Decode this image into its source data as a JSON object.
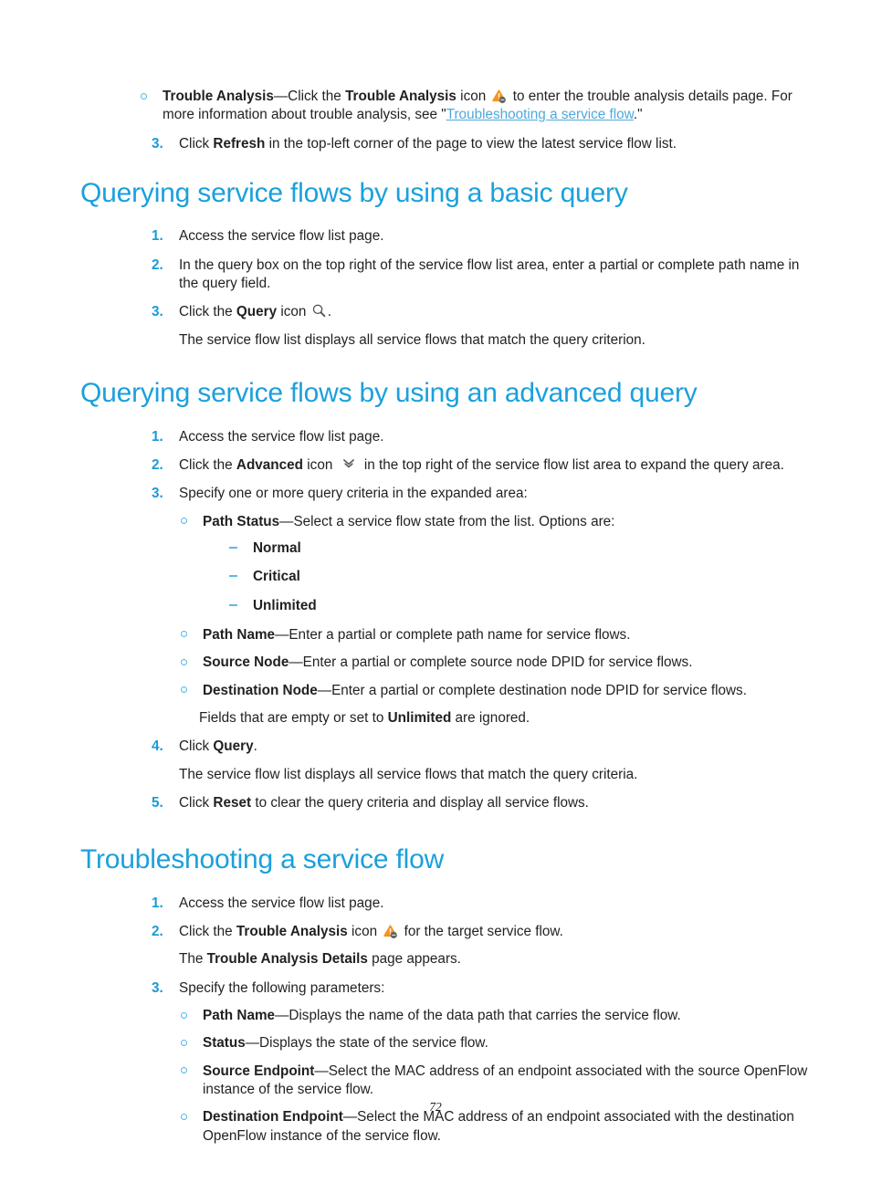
{
  "document": {
    "page_number": "72",
    "heading_color": "#1ba0dc",
    "marker_color": "#1b9ad6",
    "bullet_color": "#4cb8e8",
    "link_color": "#4da9dc",
    "warning_icon_color": "#f7941e"
  },
  "top_continued": {
    "bullet": {
      "term": "Trouble Analysis",
      "dash": "—",
      "text_before_bold": "Click the ",
      "bold_inline": "Trouble Analysis",
      "text_after_bold": " icon ",
      "icon_name": "trouble-analysis-icon",
      "text_after_icon": " to enter the trouble analysis details page. For more information about trouble analysis, see \"",
      "link_text": "Troubleshooting a service flow",
      "text_end": ".\""
    },
    "step3": {
      "number": "3.",
      "text_before": "Click ",
      "bold": "Refresh",
      "text_after": " in the top-left corner of the page to view the latest service flow list."
    }
  },
  "section_basic_query": {
    "heading": "Querying service flows by using a basic query",
    "steps": [
      {
        "number": "1.",
        "text": "Access the service flow list page."
      },
      {
        "number": "2.",
        "text": "In the query box on the top right of the service flow list area, enter a partial or complete path name in the query field."
      },
      {
        "number": "3.",
        "text_before": "Click the ",
        "bold": "Query",
        "text_after": " icon ",
        "icon_name": "search-icon",
        "text_end": ".",
        "sub_paragraph": "The service flow list displays all service flows that match the query criterion."
      }
    ]
  },
  "section_advanced_query": {
    "heading": "Querying service flows by using an advanced query",
    "steps": [
      {
        "number": "1.",
        "text": "Access the service flow list page."
      },
      {
        "number": "2.",
        "text_before": "Click the ",
        "bold": "Advanced",
        "text_after": " icon ",
        "icon_name": "double-chevron-down-icon",
        "text_end": " in the top right of the service flow list area to expand the query area."
      },
      {
        "number": "3.",
        "text": "Specify one or more query criteria in the expanded area:",
        "bullets": [
          {
            "term": "Path Status",
            "dash": "—",
            "description": "Select a service flow state from the list. Options are:",
            "options": [
              "Normal",
              "Critical",
              "Unlimited"
            ]
          },
          {
            "term": "Path Name",
            "dash": "—",
            "description": "Enter a partial or complete path name for service flows."
          },
          {
            "term": "Source Node",
            "dash": "—",
            "description": "Enter a partial or complete source node DPID for service flows."
          },
          {
            "term": "Destination Node",
            "dash": "—",
            "description": "Enter a partial or complete destination node DPID for service flows."
          }
        ],
        "trailing_text_before": "Fields that are empty or set to ",
        "trailing_bold": "Unlimited",
        "trailing_text_after": " are ignored."
      },
      {
        "number": "4.",
        "text_before": "Click ",
        "bold": "Query",
        "text_end": ".",
        "sub_paragraph": "The service flow list displays all service flows that match the query criteria."
      },
      {
        "number": "5.",
        "text_before": "Click ",
        "bold": "Reset",
        "text_end": " to clear the query criteria and display all service flows."
      }
    ]
  },
  "section_troubleshooting": {
    "heading": "Troubleshooting a service flow",
    "steps": [
      {
        "number": "1.",
        "text": "Access the service flow list page."
      },
      {
        "number": "2.",
        "text_before": "Click the ",
        "bold": "Trouble Analysis",
        "text_after": " icon ",
        "icon_name": "trouble-analysis-icon",
        "text_end": " for the target service flow.",
        "sub_before": "The ",
        "sub_bold": "Trouble Analysis Details",
        "sub_after": " page appears."
      },
      {
        "number": "3.",
        "text": "Specify the following parameters:",
        "bullets": [
          {
            "term": "Path Name",
            "dash": "—",
            "description": "Displays the name of the data path that carries the service flow."
          },
          {
            "term": "Status",
            "dash": "—",
            "description": "Displays the state of the service flow."
          },
          {
            "term": "Source Endpoint",
            "dash": "—",
            "description": "Select the MAC address of an endpoint associated with the source OpenFlow instance of the service flow."
          },
          {
            "term": "Destination Endpoint",
            "dash": "—",
            "description": "Select the MAC address of an endpoint associated with the destination OpenFlow instance of the service flow."
          }
        ]
      }
    ]
  }
}
